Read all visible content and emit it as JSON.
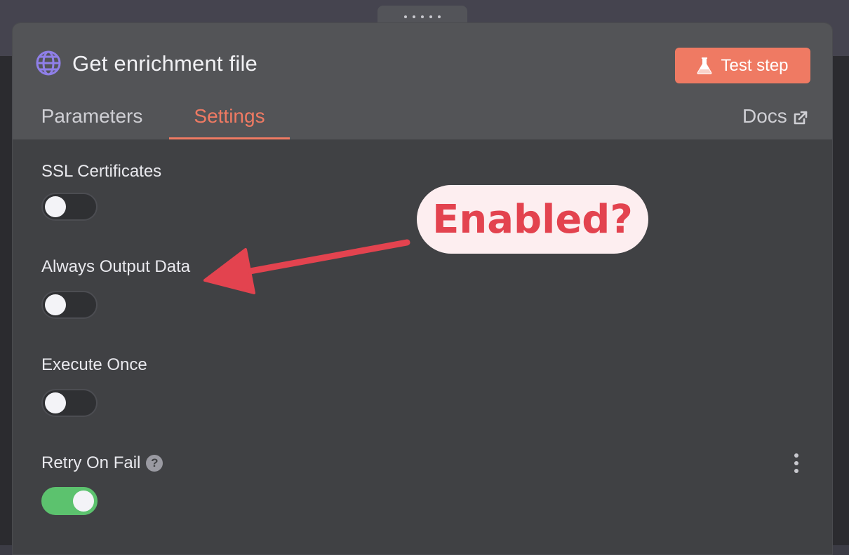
{
  "node": {
    "title": "Get enrichment file",
    "icon": "globe-icon",
    "test_button_label": "Test step"
  },
  "tabs": [
    {
      "label": "Parameters",
      "active": false
    },
    {
      "label": "Settings",
      "active": true
    }
  ],
  "docs_label": "Docs",
  "settings": [
    {
      "label": "SSL Certificates",
      "enabled": false
    },
    {
      "label": "Always Output Data",
      "enabled": false
    },
    {
      "label": "Execute Once",
      "enabled": false
    },
    {
      "label": "Retry On Fail",
      "enabled": true
    }
  ],
  "annotation": {
    "text": "Enabled?"
  },
  "colors": {
    "accent": "#ef7a63",
    "toggle_on": "#5cc26e",
    "annotation": "#e3434f",
    "globe": "#8f7fe8"
  }
}
